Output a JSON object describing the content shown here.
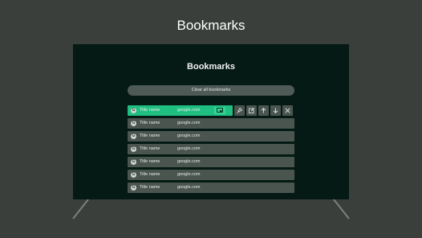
{
  "page": {
    "title": "Bookmarks"
  },
  "screen": {
    "title": "Bookmarks",
    "clear_all_label": "Clear all bookmarks",
    "bookmarks": [
      {
        "favicon": "G",
        "title": "Title name",
        "url": "google.com",
        "selected": true
      },
      {
        "favicon": "G",
        "title": "Title name",
        "url": "google.com"
      },
      {
        "favicon": "G",
        "title": "Title name",
        "url": "google.com"
      },
      {
        "favicon": "G",
        "title": "Title name",
        "url": "google.com"
      },
      {
        "favicon": "G",
        "title": "Title name",
        "url": "google.com"
      },
      {
        "favicon": "G",
        "title": "Title name",
        "url": "google.com"
      },
      {
        "favicon": "G",
        "title": "Title name",
        "url": "google.com"
      }
    ],
    "row_actions": [
      "pin-icon",
      "edit-icon",
      "arrow-up-icon",
      "arrow-down-icon",
      "close-icon"
    ]
  },
  "colors": {
    "accent": "#1fbf82",
    "screen_bg": "#051a14",
    "page_bg": "#3a3f3c"
  }
}
